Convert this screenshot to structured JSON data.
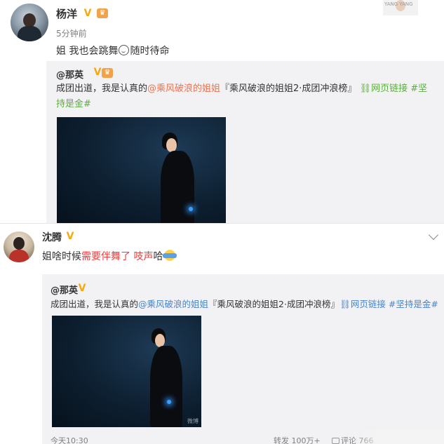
{
  "post1": {
    "username": "杨洋",
    "time": "5分钟前",
    "text_a": "姐 我也会跳舞",
    "text_b": "随时待命",
    "corner_label": "YANG YANG",
    "repost": {
      "username": "@那英",
      "text_a": "成团出道，我是认真的",
      "mention": "@乘风破浪的姐姐",
      "topic": "『乘风破浪的姐姐2·成团冲浪榜』",
      "link_label": "网页链接",
      "hashtag": "#坚持是金#"
    }
  },
  "post2": {
    "username": "沈腾",
    "text_a": "姐啥时候",
    "text_red_a": "需要伴舞了",
    "text_red_b": "吱声",
    "text_c": "哈",
    "repost": {
      "username": "@那英",
      "text_a": "成团出道，我是认真的",
      "mention": "@乘风破浪的姐姐",
      "topic": "『乘风破浪的姐姐2·成团冲浪榜』",
      "link_label": "网页链接",
      "hashtag": "#坚持是金#",
      "photo_watermark": "微博",
      "time": "今天10:30",
      "repost_count": "转发 100万+",
      "comment_count": "评论 766"
    }
  },
  "badges": {
    "verified_symbol": "V",
    "member_symbol": "♛"
  },
  "colors": {
    "verified": "#f7a80a",
    "link": "#eb7350",
    "highlight_red": "#eb3c3c",
    "repost_bg": "#f2f2f5"
  }
}
